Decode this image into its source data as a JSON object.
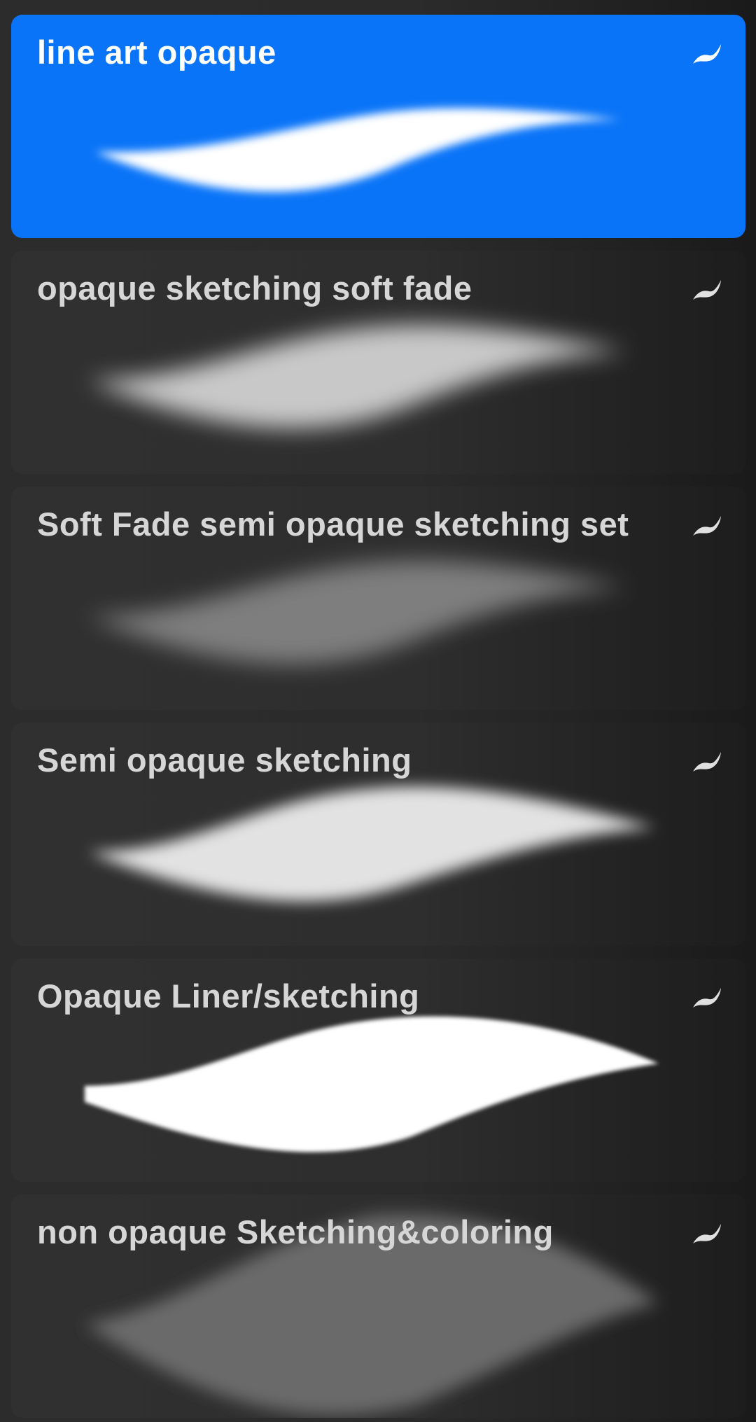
{
  "brushes": [
    {
      "name": "line art opaque",
      "selected": true,
      "icon": "brush-stroke-icon",
      "stroke_color": "#ffffff",
      "stroke_opacity": 1.0
    },
    {
      "name": "opaque sketching soft fade",
      "selected": false,
      "icon": "brush-stroke-icon",
      "stroke_color": "#c8c8c8",
      "stroke_opacity": 0.85
    },
    {
      "name": "Soft Fade semi opaque sketching set",
      "selected": false,
      "icon": "brush-stroke-icon",
      "stroke_color": "#8c8c8c",
      "stroke_opacity": 0.8
    },
    {
      "name": "Semi opaque sketching",
      "selected": false,
      "icon": "brush-stroke-icon",
      "stroke_color": "#e2e2e2",
      "stroke_opacity": 0.95
    },
    {
      "name": "Opaque Liner/sketching",
      "selected": false,
      "icon": "brush-stroke-icon",
      "stroke_color": "#ffffff",
      "stroke_opacity": 1.0
    },
    {
      "name": "non opaque Sketching&coloring",
      "selected": false,
      "icon": "brush-stroke-icon",
      "stroke_color": "#6a6a6a",
      "stroke_opacity": 0.9
    }
  ],
  "colors": {
    "selected_bg": "#0a74f8",
    "card_bg": "#2e2e2e",
    "text": "#d6d6d6",
    "selected_text": "#ffffff"
  }
}
